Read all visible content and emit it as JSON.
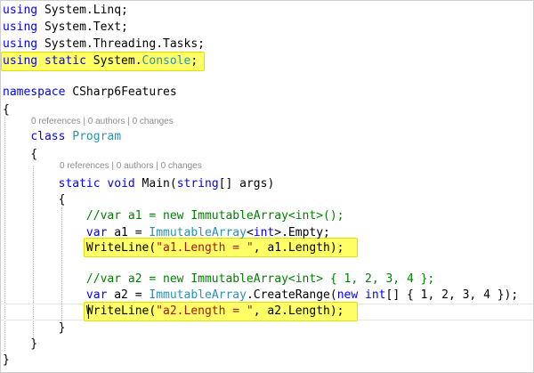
{
  "editor": {
    "lines": [
      [
        [
          "kw",
          "using"
        ],
        [
          "tx",
          " System.Linq;"
        ]
      ],
      [
        [
          "kw",
          "using"
        ],
        [
          "tx",
          " System.Text;"
        ]
      ],
      [
        [
          "kw",
          "using"
        ],
        [
          "tx",
          " System.Threading.Tasks;"
        ]
      ],
      [
        [
          "kw",
          "using static"
        ],
        [
          "tx",
          " System."
        ],
        [
          "ty",
          "Console"
        ],
        [
          "tx",
          ";"
        ]
      ],
      [],
      [
        [
          "kw",
          "namespace"
        ],
        [
          "tx",
          " CSharp6Features"
        ]
      ],
      [
        [
          "tx",
          "{"
        ]
      ],
      [
        [
          "tx",
          "    "
        ],
        [
          "kw",
          "class"
        ],
        [
          "tx",
          " "
        ],
        [
          "ty",
          "Program"
        ]
      ],
      [
        [
          "tx",
          "    {"
        ]
      ],
      [
        [
          "tx",
          "        "
        ],
        [
          "kw",
          "static void"
        ],
        [
          "tx",
          " Main("
        ],
        [
          "kw",
          "string"
        ],
        [
          "tx",
          "[] args)"
        ]
      ],
      [
        [
          "tx",
          "        {"
        ]
      ],
      [
        [
          "tx",
          "            "
        ],
        [
          "cm",
          "//var a1 = new ImmutableArray<int>();"
        ]
      ],
      [
        [
          "tx",
          "            "
        ],
        [
          "kw",
          "var"
        ],
        [
          "tx",
          " a1 = "
        ],
        [
          "ty",
          "ImmutableArray"
        ],
        [
          "tx",
          "<"
        ],
        [
          "kw",
          "int"
        ],
        [
          "tx",
          ">.Empty;"
        ]
      ],
      [
        [
          "tx",
          "            WriteLine("
        ],
        [
          "st",
          "\"a1.Length = \""
        ],
        [
          "tx",
          ", a1.Length);"
        ]
      ],
      [],
      [
        [
          "tx",
          "            "
        ],
        [
          "cm",
          "//var a2 = new ImmutableArray<int> { 1, 2, 3, 4 };"
        ]
      ],
      [
        [
          "tx",
          "            "
        ],
        [
          "kw",
          "var"
        ],
        [
          "tx",
          " a2 = "
        ],
        [
          "ty",
          "ImmutableArray"
        ],
        [
          "tx",
          ".CreateRange("
        ],
        [
          "kw",
          "new int"
        ],
        [
          "tx",
          "[] { 1, 2, 3, 4 });"
        ]
      ],
      [
        [
          "tx",
          "            WriteLine("
        ],
        [
          "st",
          "\"a2.Length = \""
        ],
        [
          "tx",
          ", a2.Length);"
        ]
      ],
      [
        [
          "tx",
          "        }"
        ]
      ],
      [
        [
          "tx",
          "    }"
        ]
      ],
      [
        [
          "tx",
          "}"
        ]
      ]
    ],
    "codelens": {
      "class_program": "0 references | 0 authors | 0 changes",
      "method_main": "0 references | 0 authors | 0 changes"
    },
    "highlighted_lines": [
      3,
      13,
      17
    ],
    "current_line": 17
  }
}
